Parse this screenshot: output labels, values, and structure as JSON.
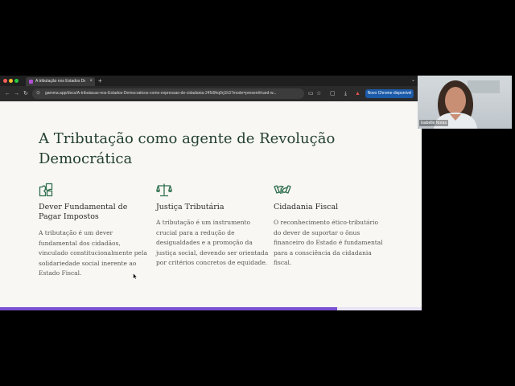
{
  "browser": {
    "tab_title": "A tributação nos Estados De",
    "tab_close": "×",
    "new_tab": "+",
    "tab_menu": "⌄",
    "url": "gamma.app/docs/A-tributacao-nos-Estados-Democraticos-como-expressao-de-cidadania-245t9hq0rj1h37mode=present#card-w...",
    "update_button": "Novo Chrome disponível"
  },
  "slide": {
    "title": "A Tributação como agente de Revolução Democrática",
    "columns": [
      {
        "icon": "puzzle-icon",
        "title": "Dever Fundamental de Pagar Impostos",
        "body": "A tributação é um dever fundamental dos cidadãos, vinculado constitucionalmente pela solidariedade social inerente ao Estado Fiscal."
      },
      {
        "icon": "scales-icon",
        "title": "Justiça Tributária",
        "body": "A tributação é um instrumento crucial para a redução de desigualdades e a promoção da justiça social, devendo ser orientada por critérios concretos de equidade."
      },
      {
        "icon": "handshake-icon",
        "title": "Cidadania Fiscal",
        "body": "O reconhecimento ético-tributário do dever de suportar o ônus financeiro do Estado é fundamental para a consciência da cidadania fiscal."
      }
    ],
    "progress_fraction": 0.8
  },
  "webcam": {
    "name": "Isabelle Noras"
  },
  "colors": {
    "title": "#24412f",
    "icon": "#2f6e4e",
    "progress": "#7a4fd1"
  }
}
